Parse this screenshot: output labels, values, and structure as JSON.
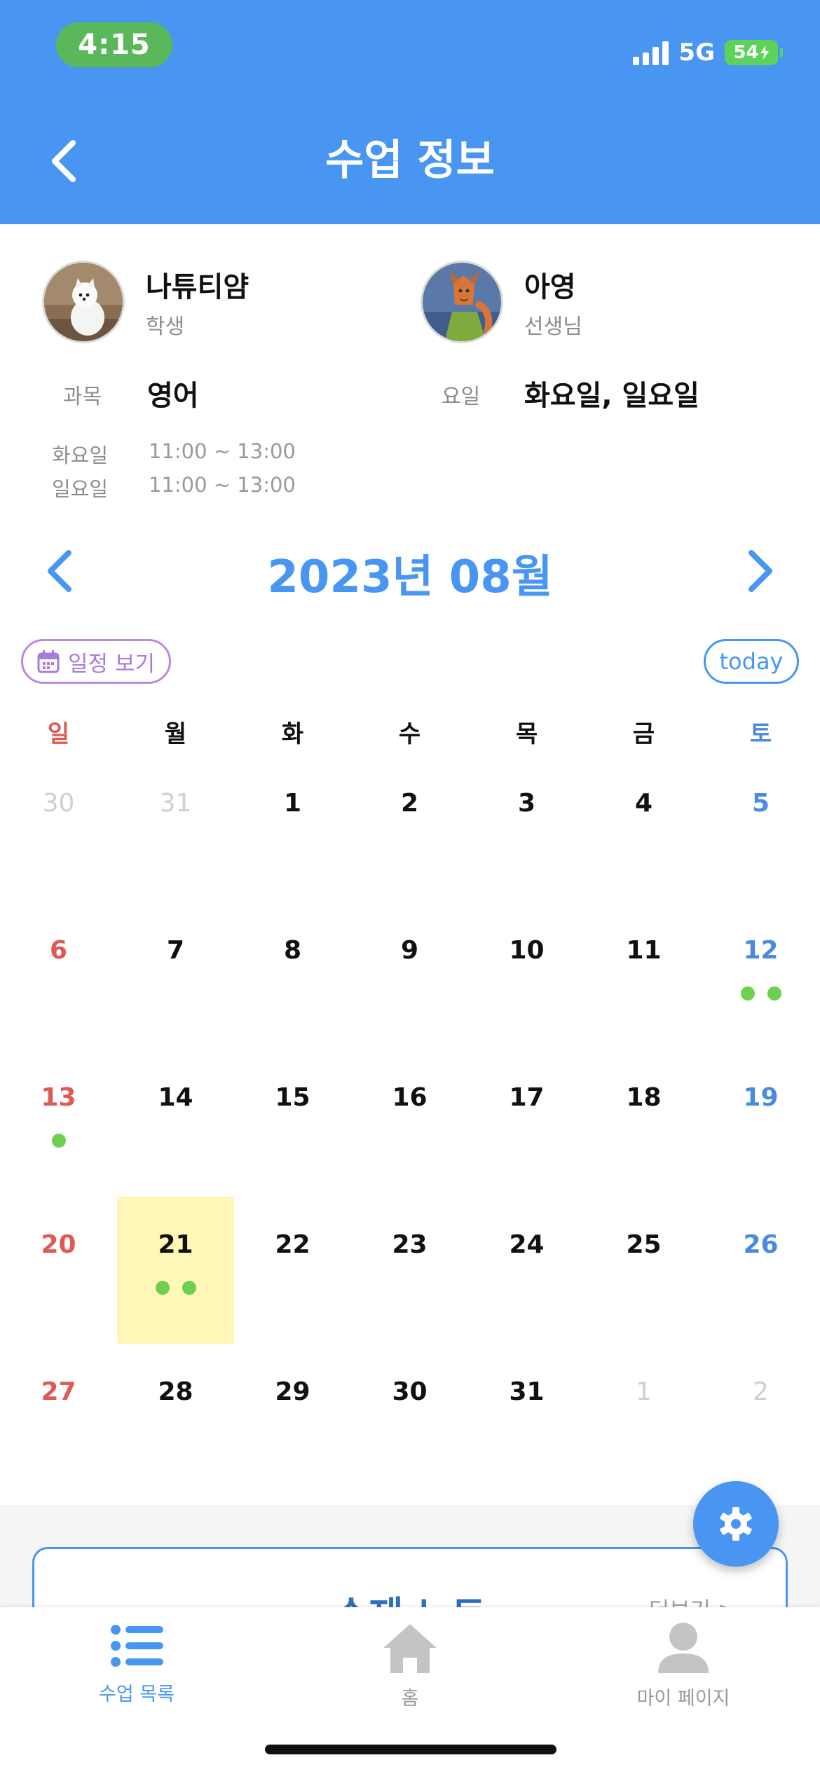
{
  "status_bar": {
    "time": "4:15",
    "network": "5G",
    "battery": "54"
  },
  "header": {
    "title": "수업 정보"
  },
  "student": {
    "name": "나튜티얌",
    "role": "학생"
  },
  "teacher": {
    "name": "아영",
    "role": "선생님"
  },
  "class_info": {
    "subject_label": "과목",
    "subject_value": "영어",
    "days_label": "요일",
    "days_value": "화요일, 일요일",
    "schedule": [
      {
        "day": "화요일",
        "time": "11:00 ~ 13:00"
      },
      {
        "day": "일요일",
        "time": "11:00 ~ 13:00"
      }
    ]
  },
  "calendar": {
    "month_title": "2023년 08월",
    "view_schedule_label": "일정 보기",
    "today_label": "today",
    "weekdays": [
      "일",
      "월",
      "화",
      "수",
      "목",
      "금",
      "토"
    ],
    "weeks": [
      [
        {
          "d": "30",
          "other": true
        },
        {
          "d": "31",
          "other": true
        },
        {
          "d": "1"
        },
        {
          "d": "2"
        },
        {
          "d": "3"
        },
        {
          "d": "4"
        },
        {
          "d": "5"
        }
      ],
      [
        {
          "d": "6"
        },
        {
          "d": "7"
        },
        {
          "d": "8"
        },
        {
          "d": "9"
        },
        {
          "d": "10"
        },
        {
          "d": "11"
        },
        {
          "d": "12",
          "dots": 2
        }
      ],
      [
        {
          "d": "13",
          "dots": 1
        },
        {
          "d": "14"
        },
        {
          "d": "15"
        },
        {
          "d": "16"
        },
        {
          "d": "17"
        },
        {
          "d": "18"
        },
        {
          "d": "19"
        }
      ],
      [
        {
          "d": "20"
        },
        {
          "d": "21",
          "dots": 2,
          "today": true
        },
        {
          "d": "22"
        },
        {
          "d": "23"
        },
        {
          "d": "24"
        },
        {
          "d": "25"
        },
        {
          "d": "26"
        }
      ],
      [
        {
          "d": "27"
        },
        {
          "d": "28"
        },
        {
          "d": "29"
        },
        {
          "d": "30"
        },
        {
          "d": "31"
        },
        {
          "d": "1",
          "other": true
        },
        {
          "d": "2",
          "other": true
        }
      ]
    ]
  },
  "note_card": {
    "title": "수제 노트",
    "more_label": "더보기 >"
  },
  "tabbar": {
    "items": [
      {
        "label": "수업 목록",
        "icon": "list-icon",
        "active": true
      },
      {
        "label": "홈",
        "icon": "home-icon",
        "active": false
      },
      {
        "label": "마이 페이지",
        "icon": "person-icon",
        "active": false
      }
    ]
  },
  "colors": {
    "primary": "#4896F2",
    "event_dot": "#6ED04F",
    "today_highlight": "#FFF7B8",
    "sunday": "#E05A55",
    "saturday": "#4A8BE0"
  }
}
